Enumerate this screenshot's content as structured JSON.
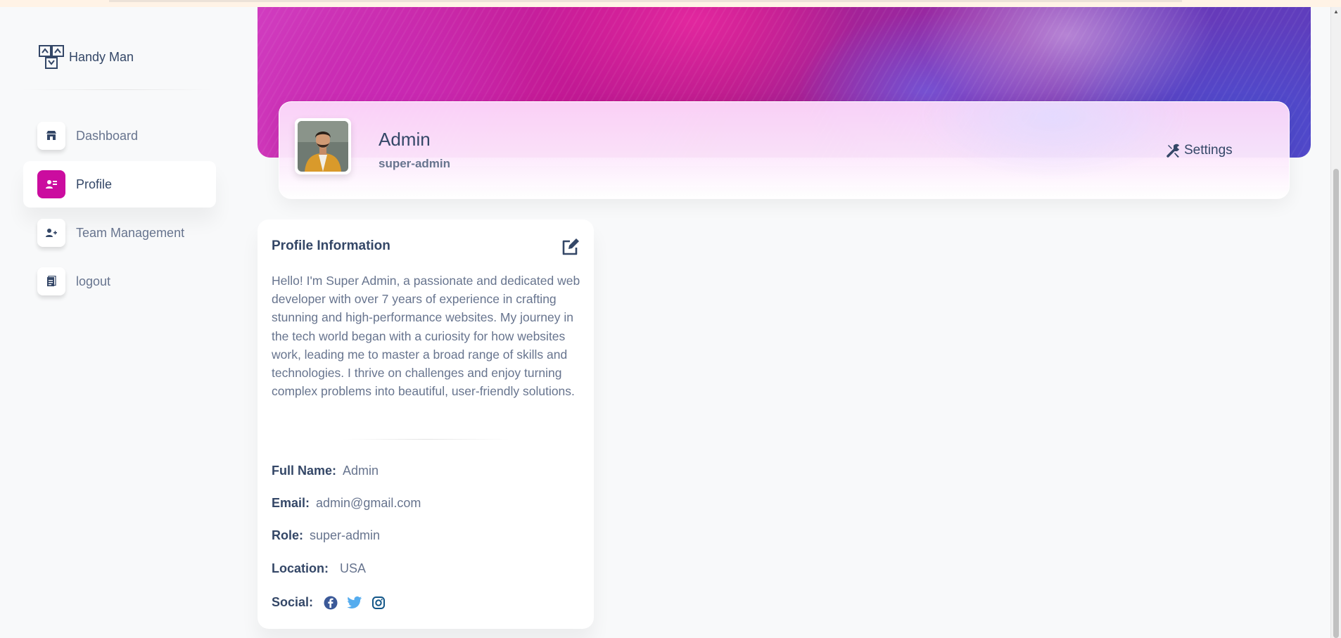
{
  "brand": {
    "name": "Handy Man"
  },
  "sidebar": {
    "items": [
      {
        "label": "Dashboard",
        "icon": "shop-icon",
        "active": false
      },
      {
        "label": "Profile",
        "icon": "profile-icon",
        "active": true
      },
      {
        "label": "Team Management",
        "icon": "add-user-icon",
        "active": false
      },
      {
        "label": "logout",
        "icon": "document-icon",
        "active": false
      }
    ]
  },
  "header": {
    "name": "Admin",
    "role": "super-admin",
    "settings_label": "Settings"
  },
  "profile_info": {
    "title": "Profile Information",
    "bio": "Hello! I'm Super Admin, a passionate and dedicated web developer with over 7 years of experience in crafting stunning and high-performance websites. My journey in the tech world began with a curiosity for how websites work, leading me to master a broad range of skills and technologies. I thrive on challenges and enjoy turning complex problems into beautiful, user-friendly solutions.",
    "fields": {
      "full_name": {
        "label": "Full Name:",
        "value": "Admin"
      },
      "email": {
        "label": "Email:",
        "value": "admin@gmail.com"
      },
      "role": {
        "label": "Role:",
        "value": "super-admin"
      },
      "location": {
        "label": "Location:",
        "value": "USA"
      },
      "social": {
        "label": "Social:",
        "icons": [
          "facebook-icon",
          "twitter-icon",
          "instagram-icon"
        ]
      }
    }
  },
  "colors": {
    "accent": "#cb0c9f",
    "text_dark": "#344767",
    "text_muted": "#67748e",
    "background": "#f8f9fa",
    "facebook": "#3b5998",
    "twitter": "#55acee",
    "instagram": "#125688"
  }
}
